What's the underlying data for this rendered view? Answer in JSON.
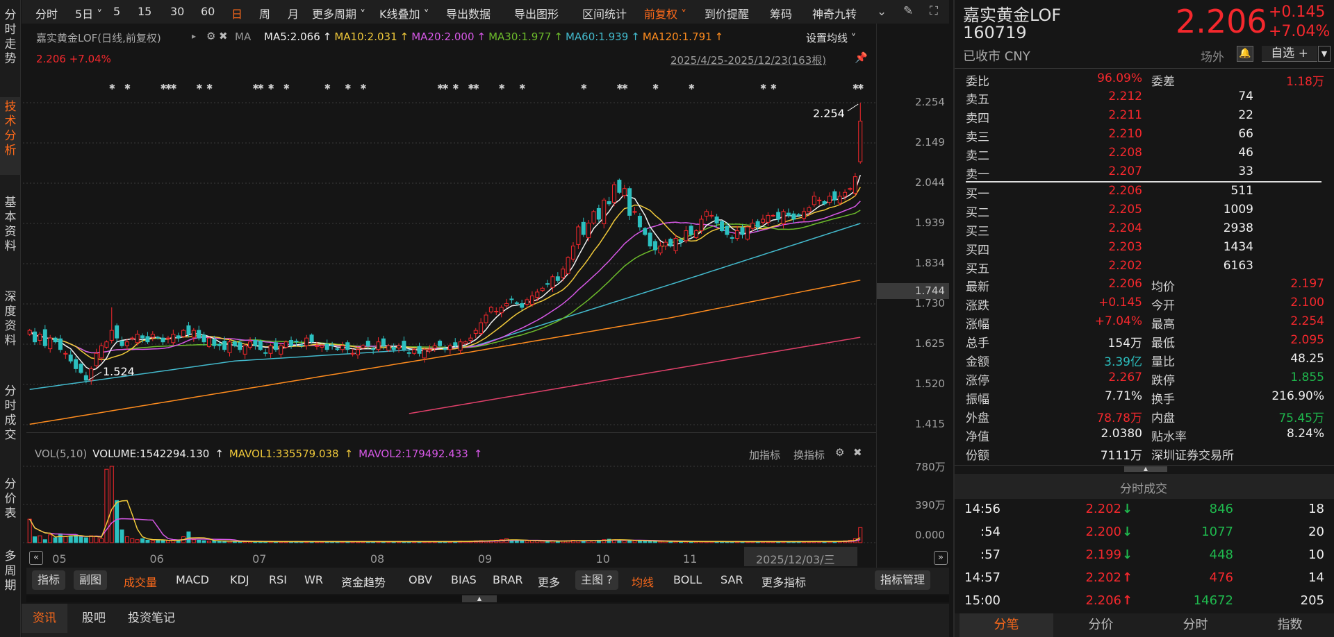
{
  "sidebar": {
    "items": [
      {
        "label": "分时走势",
        "active": false
      },
      {
        "label": "技术分析",
        "active": true
      },
      {
        "label": "基本资料",
        "active": false
      },
      {
        "label": "深度资料",
        "active": false
      },
      {
        "label": "分时成交",
        "active": false
      },
      {
        "label": "分价表",
        "active": false
      },
      {
        "label": "多周期",
        "active": false
      }
    ]
  },
  "toolbar": {
    "items": [
      "分时",
      "5日 ˅",
      "5",
      "15",
      "30",
      "60",
      "日",
      "周",
      "月",
      "更多周期 ˅",
      "K线叠加 ˅",
      "导出数据",
      "导出图形",
      "区间统计",
      "前复权 ˅",
      "到价提醒",
      "筹码",
      "神奇九转"
    ],
    "active": [
      "日",
      "前复权 ˅"
    ]
  },
  "chart_header": {
    "title": "嘉实黄金LOF(日线,前复权)",
    "ma_label": "MA",
    "ma5": "MA5:2.066",
    "ma10": "MA10:2.031",
    "ma20": "MA20:2.000",
    "ma30": "MA30:1.977",
    "ma60": "MA60:1.939",
    "ma120": "MA120:1.791",
    "arrow": "↑",
    "set_ma": "设置均线 ˅",
    "price_change": "2.206 +7.04%",
    "date_range": "2025/4/25-2025/12/23(163根)"
  },
  "volume_header": {
    "label": "VOL(5,10)",
    "volume": "VOLUME:1542294.130",
    "mavol1": "MAVOL1:335579.038",
    "mavol2": "MAVOL2:179492.433",
    "add": "加指标",
    "switch": "换指标"
  },
  "date_tooltip": "2025/12/03/三",
  "price_box": "1.744",
  "indicator_bar": {
    "indicator_btn": "指标",
    "sub_btn": "副图",
    "items": [
      "成交量",
      "MACD",
      "KDJ",
      "RSI",
      "WR",
      "资金趋势",
      "OBV",
      "BIAS",
      "BRAR",
      "更多"
    ],
    "main_btn": "主图 ?",
    "main_items": [
      "均线",
      "BOLL",
      "SAR",
      "更多指标"
    ],
    "manage_btn": "指标管理"
  },
  "bottom_tabs": [
    "资讯",
    "股吧",
    "投资笔记"
  ],
  "quote": {
    "name": "嘉实黄金LOF",
    "code": "160719",
    "status": "已收市 CNY",
    "price": "2.206",
    "change": "+0.145",
    "change_pct": "+7.04%",
    "market": "场外",
    "watchlist": "自选 +",
    "wei_bi_label": "委比",
    "wei_bi": "96.09%",
    "wei_cha_label": "委差",
    "wei_cha": "1.18万",
    "asks": [
      {
        "label": "卖五",
        "price": "2.212",
        "vol": "74"
      },
      {
        "label": "卖四",
        "price": "2.211",
        "vol": "22"
      },
      {
        "label": "卖三",
        "price": "2.210",
        "vol": "66"
      },
      {
        "label": "卖二",
        "price": "2.208",
        "vol": "46"
      },
      {
        "label": "卖一",
        "price": "2.207",
        "vol": "33"
      }
    ],
    "bids": [
      {
        "label": "买一",
        "price": "2.206",
        "vol": "511"
      },
      {
        "label": "买二",
        "price": "2.205",
        "vol": "1009"
      },
      {
        "label": "买三",
        "price": "2.204",
        "vol": "2938"
      },
      {
        "label": "买四",
        "price": "2.203",
        "vol": "1434"
      },
      {
        "label": "买五",
        "price": "2.202",
        "vol": "6163"
      }
    ],
    "stats": [
      {
        "l1": "最新",
        "v1": "2.206",
        "c1": "red",
        "l2": "均价",
        "v2": "2.197",
        "c2": "red"
      },
      {
        "l1": "涨跌",
        "v1": "+0.145",
        "c1": "red",
        "l2": "今开",
        "v2": "2.100",
        "c2": "red"
      },
      {
        "l1": "涨幅",
        "v1": "+7.04%",
        "c1": "red",
        "l2": "最高",
        "v2": "2.254",
        "c2": "red"
      },
      {
        "l1": "总手",
        "v1": "154万",
        "c1": "wt",
        "l2": "最低",
        "v2": "2.095",
        "c2": "red"
      },
      {
        "l1": "金额",
        "v1": "3.39亿",
        "c1": "cyan",
        "l2": "量比",
        "v2": "48.25",
        "c2": "wt"
      },
      {
        "l1": "涨停",
        "v1": "2.267",
        "c1": "red",
        "l2": "跌停",
        "v2": "1.855",
        "c2": "green"
      },
      {
        "l1": "振幅",
        "v1": "7.71%",
        "c1": "wt",
        "l2": "换手",
        "v2": "216.90%",
        "c2": "wt"
      },
      {
        "l1": "外盘",
        "v1": "78.78万",
        "c1": "red",
        "l2": "内盘",
        "v2": "75.45万",
        "c2": "green"
      },
      {
        "l1": "净值",
        "v1": "2.0380",
        "c1": "wt",
        "l2": "贴水率",
        "v2": "8.24%",
        "c2": "wt"
      },
      {
        "l1": "份额",
        "v1": "7111万",
        "c1": "wt",
        "l2": "深圳证券交易所",
        "v2": "",
        "c2": "wt"
      }
    ]
  },
  "trades": {
    "title": "分时成交",
    "rows": [
      {
        "time": "14:56",
        "price": "2.202",
        "dir": "down",
        "vol": "846",
        "vc": "green",
        "count": "18"
      },
      {
        "time": ":54",
        "price": "2.200",
        "dir": "down",
        "vol": "1077",
        "vc": "green",
        "count": "20"
      },
      {
        "time": ":57",
        "price": "2.199",
        "dir": "down",
        "vol": "448",
        "vc": "green",
        "count": "10"
      },
      {
        "time": "14:57",
        "price": "2.202",
        "dir": "up",
        "vol": "476",
        "vc": "red",
        "count": "14"
      },
      {
        "time": "15:00",
        "price": "2.206",
        "dir": "up",
        "vol": "14672",
        "vc": "green",
        "count": "205"
      }
    ],
    "tabs": [
      "分笔",
      "分价",
      "分时",
      "指数"
    ]
  },
  "colors": {
    "up": "#f5282d",
    "down": "#2cc0c0",
    "ma5": "#f2f2f2",
    "ma10": "#f0c93a",
    "ma20": "#d658e6",
    "ma30": "#6cbb2b",
    "ma60": "#43b9cc",
    "ma120": "#ff8c1e",
    "ma250": "#e0406a"
  },
  "chart_data": {
    "type": "candlestick",
    "bars": 163,
    "y_ticks": [
      "2.254",
      "2.149",
      "2.044",
      "1.939",
      "1.834",
      "1.730",
      "1.625",
      "1.520",
      "1.415"
    ],
    "ylim": [
      1.415,
      2.254
    ],
    "close": [
      1.66,
      1.63,
      1.65,
      1.62,
      1.64,
      1.63,
      1.61,
      1.6,
      1.58,
      1.56,
      1.55,
      1.53,
      1.56,
      1.6,
      1.62,
      1.63,
      1.66,
      1.64,
      1.62,
      1.63,
      1.64,
      1.65,
      1.64,
      1.63,
      1.65,
      1.64,
      1.63,
      1.64,
      1.65,
      1.64,
      1.66,
      1.65,
      1.66,
      1.64,
      1.63,
      1.64,
      1.62,
      1.62,
      1.61,
      1.63,
      1.62,
      1.61,
      1.62,
      1.63,
      1.62,
      1.61,
      1.6,
      1.62,
      1.61,
      1.62,
      1.63,
      1.62,
      1.63,
      1.62,
      1.64,
      1.63,
      1.62,
      1.62,
      1.61,
      1.62,
      1.61,
      1.62,
      1.61,
      1.6,
      1.61,
      1.62,
      1.62,
      1.61,
      1.63,
      1.62,
      1.62,
      1.61,
      1.62,
      1.61,
      1.6,
      1.61,
      1.6,
      1.61,
      1.61,
      1.62,
      1.62,
      1.61,
      1.62,
      1.62,
      1.63,
      1.63,
      1.64,
      1.66,
      1.68,
      1.7,
      1.72,
      1.71,
      1.72,
      1.73,
      1.74,
      1.73,
      1.72,
      1.74,
      1.75,
      1.76,
      1.77,
      1.78,
      1.8,
      1.79,
      1.82,
      1.85,
      1.88,
      1.93,
      1.91,
      1.94,
      1.97,
      1.95,
      2.0,
      1.99,
      2.04,
      2.02,
      2.03,
      1.96,
      1.97,
      1.93,
      1.91,
      1.88,
      1.87,
      1.88,
      1.89,
      1.88,
      1.9,
      1.89,
      1.92,
      1.91,
      1.92,
      1.95,
      1.97,
      1.96,
      1.94,
      1.92,
      1.91,
      1.9,
      1.92,
      1.91,
      1.93,
      1.94,
      1.93,
      1.95,
      1.96,
      1.96,
      1.95,
      1.97,
      1.96,
      1.95,
      1.96,
      1.97,
      1.98,
      2.01,
      2.0,
      1.99,
      2.01,
      2.0,
      2.01,
      2.02,
      2.03,
      2.061,
      2.206
    ],
    "last_bar": {
      "open": 2.1,
      "high": 2.254,
      "low": 2.095,
      "close": 2.206
    },
    "spike_high": {
      "index": 16,
      "high": 1.72
    },
    "annotations": [
      {
        "index": 162,
        "value": "2.254"
      },
      {
        "index": 11,
        "value": "1.524"
      }
    ],
    "ma_long": {
      "ma60": [
        [
          0,
          1.506
        ],
        [
          40,
          1.58
        ],
        [
          87,
          1.62
        ],
        [
          125,
          1.78
        ],
        [
          162,
          1.939
        ]
      ],
      "ma120": [
        [
          0,
          1.415
        ],
        [
          87,
          1.606
        ],
        [
          125,
          1.693
        ],
        [
          162,
          1.791
        ]
      ],
      "ma250": [
        [
          74,
          1.443
        ],
        [
          162,
          1.642
        ]
      ]
    },
    "volume_unit": "万",
    "volume_ticks": [
      "780万",
      "390万",
      "0.000"
    ],
    "volume_ylim": [
      0,
      780
    ],
    "volume": [
      240,
      60,
      70,
      30,
      80,
      50,
      90,
      60,
      70,
      80,
      60,
      50,
      70,
      60,
      40,
      750,
      780,
      430,
      130,
      60,
      40,
      30,
      40,
      25,
      20,
      30,
      25,
      20,
      20,
      25,
      60,
      110,
      30,
      25,
      20,
      15,
      20,
      15,
      12,
      15,
      12,
      12,
      10,
      12,
      10,
      12,
      10,
      12,
      10,
      10,
      12,
      10,
      12,
      10,
      10,
      12,
      10,
      10,
      10,
      12,
      10,
      10,
      12,
      10,
      10,
      12,
      10,
      10,
      12,
      10,
      10,
      10,
      12,
      10,
      10,
      12,
      10,
      10,
      10,
      12,
      10,
      12,
      10,
      12,
      15,
      12,
      15,
      18,
      20,
      18,
      20,
      25,
      30,
      40,
      25,
      20,
      20,
      18,
      20,
      18,
      15,
      15,
      18,
      15,
      18,
      20,
      25,
      22,
      20,
      18,
      22,
      25,
      30,
      35,
      30,
      25,
      20,
      22,
      18,
      20,
      18,
      15,
      15,
      12,
      15,
      12,
      12,
      10,
      12,
      10,
      12,
      12,
      10,
      12,
      10,
      12,
      10,
      10,
      12,
      10,
      10,
      12,
      10,
      10,
      12,
      10,
      10,
      12,
      10,
      10,
      12,
      10,
      12,
      12,
      10,
      12,
      12,
      14,
      15,
      18,
      25,
      40,
      154
    ],
    "months": [
      {
        "label": "05",
        "index": 6
      },
      {
        "label": "06",
        "index": 25
      },
      {
        "label": "07",
        "index": 45
      },
      {
        "label": "08",
        "index": 68
      },
      {
        "label": "09",
        "index": 89
      },
      {
        "label": "10",
        "index": 112
      },
      {
        "label": "11",
        "index": 129
      }
    ],
    "event_markers": [
      16,
      19,
      26,
      27,
      28,
      33,
      35,
      44,
      45,
      47,
      50,
      58,
      62,
      65,
      80,
      81,
      83,
      86,
      87,
      92,
      96,
      108,
      115,
      116,
      122,
      129,
      143,
      145,
      161,
      162
    ]
  }
}
